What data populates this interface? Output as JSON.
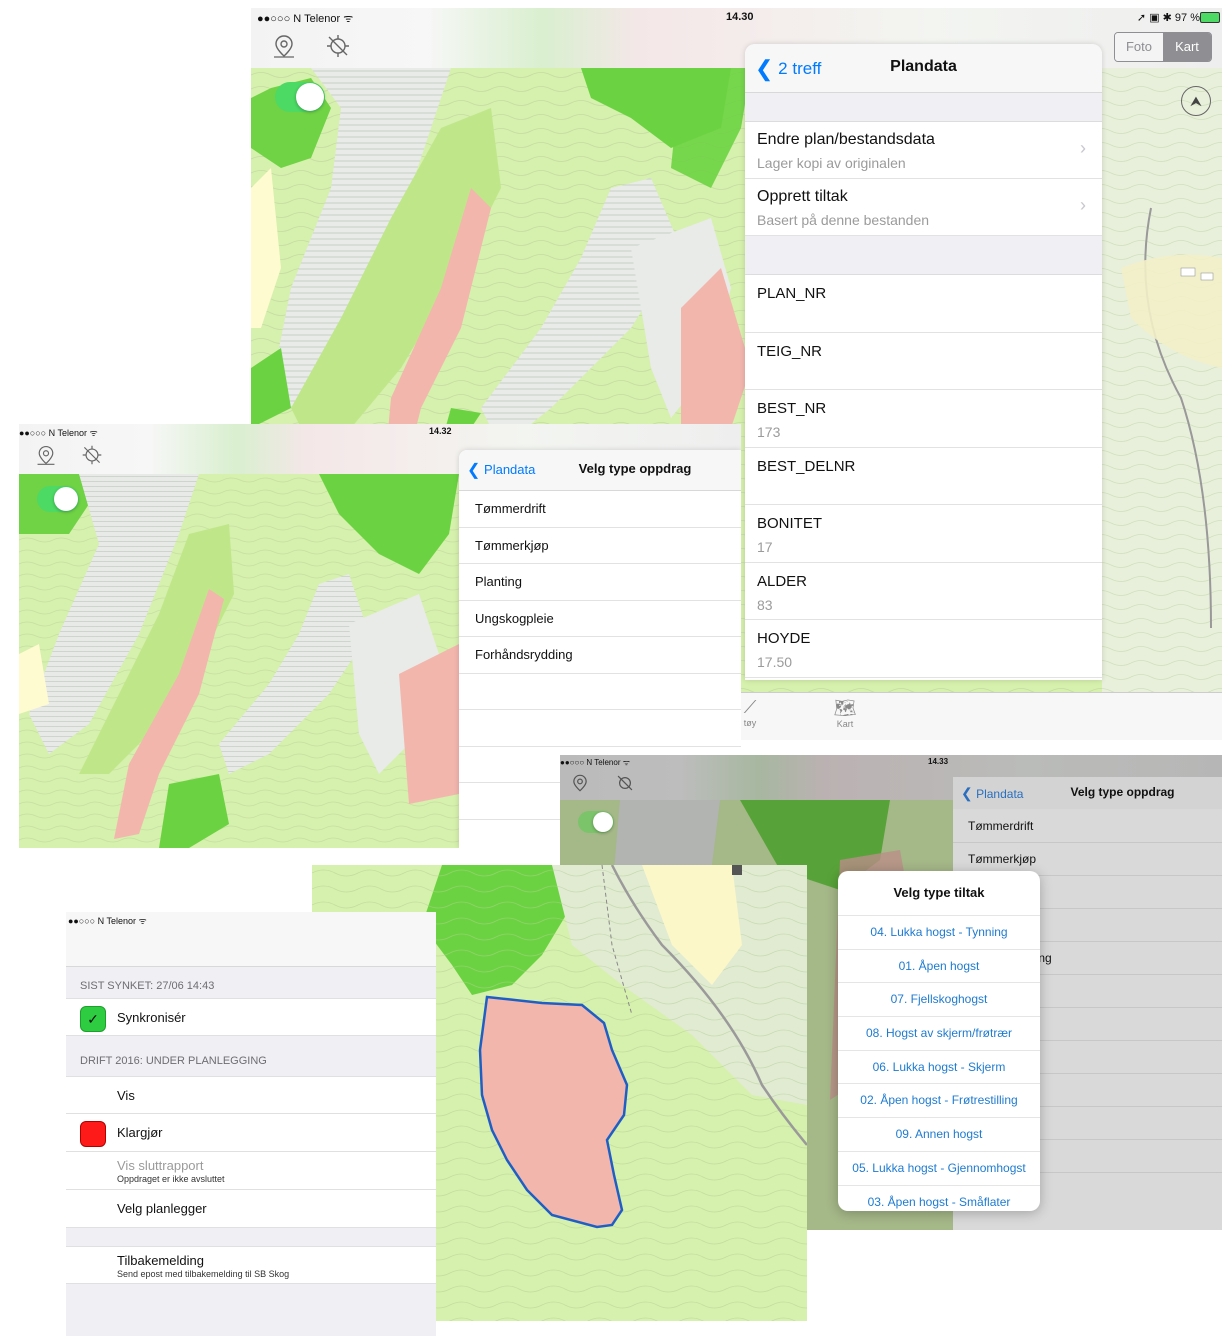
{
  "screen1": {
    "status": {
      "carrier": "●●○○○ N Telenor ᯤ",
      "time": "14.30",
      "right": "➚ ▣ ✱ 97 %"
    },
    "segmented": {
      "options": [
        "Foto",
        "Kart"
      ],
      "selected": "Kart"
    },
    "panel": {
      "back_label": "2 treff",
      "title": "Plandata",
      "actions": [
        {
          "title": "Endre plan/bestandsdata",
          "subtitle": "Lager kopi av originalen"
        },
        {
          "title": "Opprett tiltak",
          "subtitle": "Basert på denne bestanden"
        }
      ],
      "fields": [
        {
          "label": "PLAN_NR",
          "value": ""
        },
        {
          "label": "TEIG_NR",
          "value": ""
        },
        {
          "label": "BEST_NR",
          "value": "173"
        },
        {
          "label": "BEST_DELNR",
          "value": ""
        },
        {
          "label": "BONITET",
          "value": "17"
        },
        {
          "label": "ALDER",
          "value": "83"
        },
        {
          "label": "HOYDE",
          "value": "17.50"
        }
      ]
    },
    "tabbar": {
      "items": [
        {
          "label": "tøy"
        },
        {
          "label": "Kart"
        }
      ]
    }
  },
  "screen2": {
    "status": {
      "carrier": "●●○○○ N Telenor ᯤ",
      "time": "14.32"
    },
    "panel": {
      "back_label": "Plandata",
      "title": "Velg type oppdrag",
      "items": [
        "Tømmerdrift",
        "Tømmerkjøp",
        "Planting",
        "Ungskogpleie",
        "Forhåndsrydding"
      ]
    }
  },
  "screen3": {
    "status": {
      "carrier": "●●○○○ N Telenor ᯤ",
      "time": "14.33"
    },
    "panel": {
      "back_label": "Plandata",
      "title": "Velg type oppdrag",
      "items": [
        "Tømmerdrift",
        "Tømmerkjøp",
        "",
        "e",
        "ding"
      ]
    },
    "tiltak_dialog": {
      "title": "Velg type tiltak",
      "options": [
        "04. Lukka hogst - Tynning",
        "01. Åpen hogst",
        "07. Fjellskoghogst",
        "08. Hogst av skjerm/frøtrær",
        "06. Lukka hogst - Skjerm",
        "02. Åpen hogst - Frøtrestilling",
        "09. Annen hogst",
        "05. Lukka hogst - Gjennomhogst",
        "03. Åpen hogst - Småflater"
      ]
    }
  },
  "screen4": {
    "status": {
      "carrier": "●●○○○ N Telenor ᯤ"
    },
    "section1": "SIST SYNKET: 27/06 14:43",
    "sync_label": "Synkronisér",
    "section2": "DRIFT 2016: UNDER PLANLEGGING",
    "rows": [
      {
        "title": "Vis",
        "subtitle": ""
      },
      {
        "title": "Klargjør",
        "subtitle": ""
      },
      {
        "title": "Vis sluttrapport",
        "subtitle": "Oppdraget er ikke avsluttet"
      },
      {
        "title": "Velg planlegger",
        "subtitle": ""
      }
    ],
    "feedback": {
      "title": "Tilbakemelding",
      "subtitle": "Send epost med tilbakemelding til SB Skog"
    }
  },
  "colors": {
    "accent": "#007aff",
    "sync_green": "#2ecc40",
    "klargjor_red": "#ff1a1a",
    "forest_light": "#cdef9e",
    "forest_dark": "#6ad23f",
    "stand_pink": "#f2b7ae",
    "stand_gray": "#e6e9e6"
  }
}
